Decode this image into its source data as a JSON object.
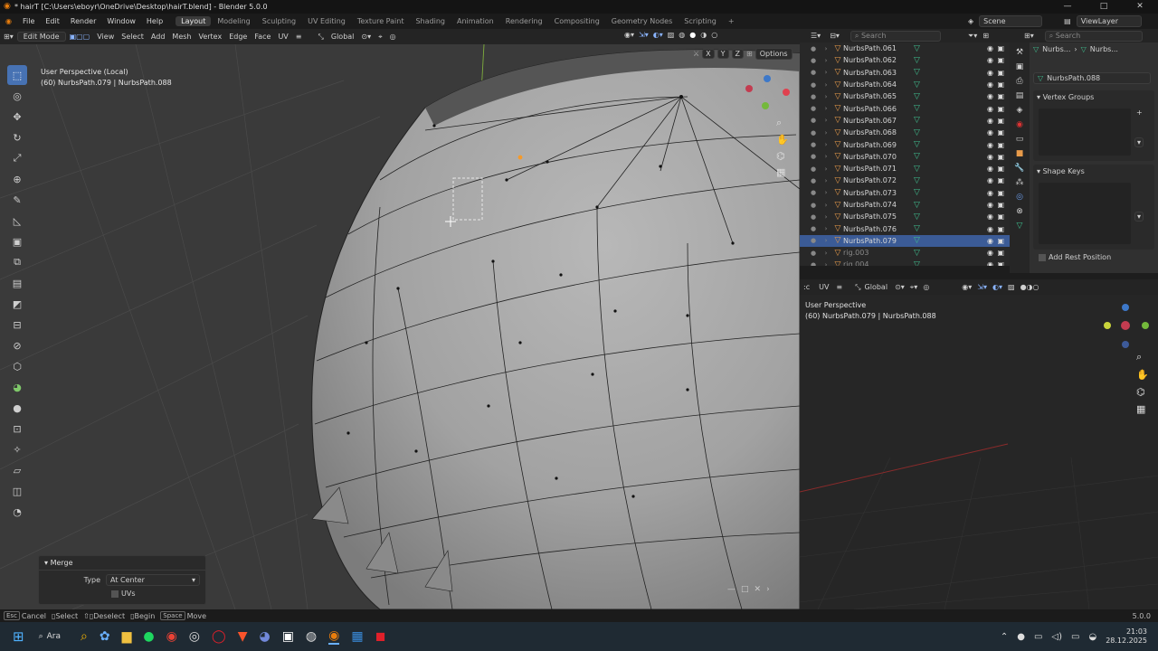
{
  "window": {
    "title": "* hairT [C:\\Users\\eboyr\\OneDrive\\Desktop\\hairT.blend] - Blender 5.0.0",
    "minimize": "—",
    "maximize": "□",
    "close": "✕"
  },
  "menu": {
    "items": [
      "File",
      "Edit",
      "Render",
      "Window",
      "Help"
    ],
    "workspaces": [
      "Layout",
      "Modeling",
      "Sculpting",
      "UV Editing",
      "Texture Paint",
      "Shading",
      "Animation",
      "Rendering",
      "Compositing",
      "Geometry Nodes",
      "Scripting"
    ],
    "active_workspace": "Layout",
    "add": "+",
    "scene": "Scene",
    "view_layer": "ViewLayer"
  },
  "viewport_header": {
    "mode": "Edit Mode",
    "menus": [
      "View",
      "Select",
      "Add",
      "Mesh",
      "Vertex",
      "Edge",
      "Face",
      "UV"
    ],
    "orientation": "Global",
    "options": "Options",
    "axes": [
      "X",
      "Y",
      "Z"
    ]
  },
  "viewport_overlay": {
    "line1": "User Perspective (Local)",
    "line2": "(60) NurbsPath.079 | NurbsPath.088"
  },
  "merge_panel": {
    "title": "Merge",
    "type_label": "Type",
    "type_value": "At Center",
    "uvs_label": "UVs"
  },
  "outliner": {
    "search_placeholder": "Search",
    "rows": [
      {
        "name": "NurbsPath.061",
        "state": "normal"
      },
      {
        "name": "NurbsPath.062",
        "state": "normal"
      },
      {
        "name": "NurbsPath.063",
        "state": "normal"
      },
      {
        "name": "NurbsPath.064",
        "state": "normal"
      },
      {
        "name": "NurbsPath.065",
        "state": "normal"
      },
      {
        "name": "NurbsPath.066",
        "state": "normal"
      },
      {
        "name": "NurbsPath.067",
        "state": "normal"
      },
      {
        "name": "NurbsPath.068",
        "state": "normal"
      },
      {
        "name": "NurbsPath.069",
        "state": "normal"
      },
      {
        "name": "NurbsPath.070",
        "state": "normal"
      },
      {
        "name": "NurbsPath.071",
        "state": "normal"
      },
      {
        "name": "NurbsPath.072",
        "state": "normal"
      },
      {
        "name": "NurbsPath.073",
        "state": "normal"
      },
      {
        "name": "NurbsPath.074",
        "state": "normal"
      },
      {
        "name": "NurbsPath.075",
        "state": "normal"
      },
      {
        "name": "NurbsPath.076",
        "state": "normal"
      },
      {
        "name": "NurbsPath.079",
        "state": "selected"
      },
      {
        "name": "rig.003",
        "state": "dim"
      },
      {
        "name": "rig.004",
        "state": "dim"
      }
    ]
  },
  "properties": {
    "search_placeholder": "Search",
    "breadcrumb_a": "Nurbs...",
    "breadcrumb_b": "Nurbs...",
    "object_name": "NurbsPath.088",
    "vertex_groups": "Vertex Groups",
    "shape_keys": "Shape Keys",
    "add_rest": "Add Rest Position"
  },
  "uv_header": {
    "menu": "UV",
    "orientation": "Global"
  },
  "uv_overlay": {
    "line1": "User Perspective",
    "line2": "(60) NurbsPath.079 | NurbsPath.088"
  },
  "status": {
    "cancel_key": "Esc",
    "cancel": "Cancel",
    "select": "Select",
    "deselect": "Deselect",
    "begin": "Begin",
    "move_key": "Space",
    "move": "Move",
    "version": "5.0.0"
  },
  "taskbar": {
    "search": "Ara",
    "time": "21:03",
    "date": "28.12.2025"
  }
}
